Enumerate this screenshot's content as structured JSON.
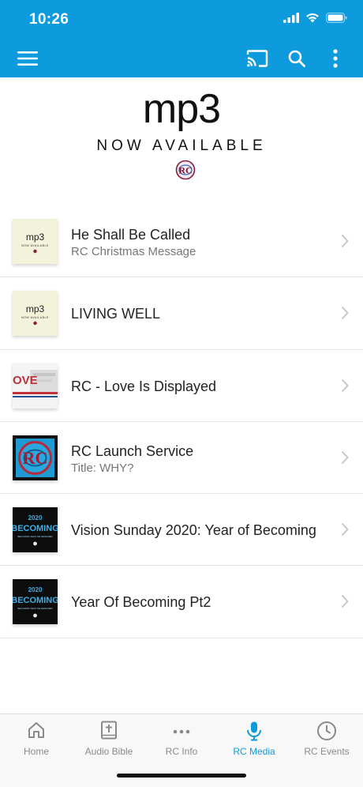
{
  "status_bar": {
    "time": "10:26"
  },
  "banner": {
    "headline": "mp3",
    "subhead": "NOW AVAILABLE"
  },
  "items": [
    {
      "title": "He Shall Be Called",
      "subtitle": "RC Christmas Message"
    },
    {
      "title": "LIVING WELL",
      "subtitle": ""
    },
    {
      "title": "RC - Love Is Displayed",
      "subtitle": ""
    },
    {
      "title": "RC Launch Service",
      "subtitle": "Title: WHY?"
    },
    {
      "title": "Vision Sunday 2020: Year of Becoming",
      "subtitle": ""
    },
    {
      "title": "Year Of Becoming Pt2",
      "subtitle": ""
    }
  ],
  "thumbs": {
    "mp3_text": "mp3",
    "mp3_sub": "NOW AVAILABLE",
    "love_text": "OVE",
    "becoming_year": "2020",
    "becoming_word": "BECOMING",
    "becoming_sub": "BECOMING WHAT HE DESIGNED"
  },
  "tabs": [
    {
      "label": "Home",
      "icon": "home-icon",
      "active": false
    },
    {
      "label": "Audio Bible",
      "icon": "bible-icon",
      "active": false
    },
    {
      "label": "RC Info",
      "icon": "more-icon",
      "active": false
    },
    {
      "label": "RC Media",
      "icon": "microphone-icon",
      "active": true
    },
    {
      "label": "RC Events",
      "icon": "clock-icon",
      "active": false
    }
  ],
  "colors": {
    "accent": "#0d9bde",
    "inactive": "#8a8a8a"
  }
}
